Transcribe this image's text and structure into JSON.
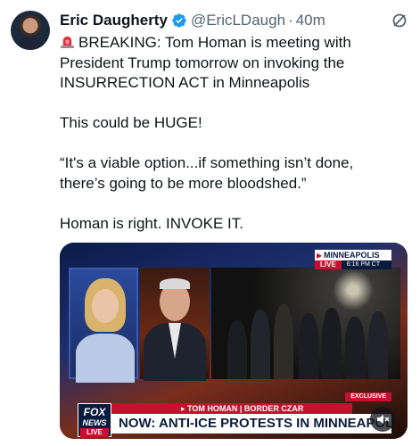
{
  "tweet": {
    "author": {
      "display_name": "Eric Daugherty",
      "handle": "@EricLDaugh",
      "verified_icon": "verified-badge-icon",
      "verified_color": "#1d9bf0"
    },
    "separator": "·",
    "timestamp": "40m",
    "more_icon": "grok-slash-icon",
    "lines": {
      "line1": "BREAKING: Tom Homan is meeting with",
      "line2": "President Trump tomorrow on invoking the",
      "line3": "INSURRECTION ACT in Minneapolis",
      "line4": "This could be HUGE!",
      "line5": "“It's a viable option...if something isn’t done,",
      "line6": "there’s going to be more bloodshed.”",
      "line7": "Homan is right. INVOKE IT."
    },
    "siren_icon": "police-siren-emoji-icon"
  },
  "video": {
    "location_label": "MINNEAPOLIS",
    "live_label": "LIVE",
    "time_label": "6:16 PM CT",
    "exclusive_label": "EXCLUSIVE",
    "name_strip": "TOM HOMAN | BORDER CZAR",
    "headline": "NOW: ANTI-ICE PROTESTS IN MINNEAPOLI",
    "logo": {
      "line1": "FOX",
      "line2": "NEWS",
      "line3": "LIVE"
    },
    "mute_icon": "speaker-muted-icon",
    "colors": {
      "brand_red": "#c8102e",
      "brand_navy": "#0a1c3d"
    }
  }
}
